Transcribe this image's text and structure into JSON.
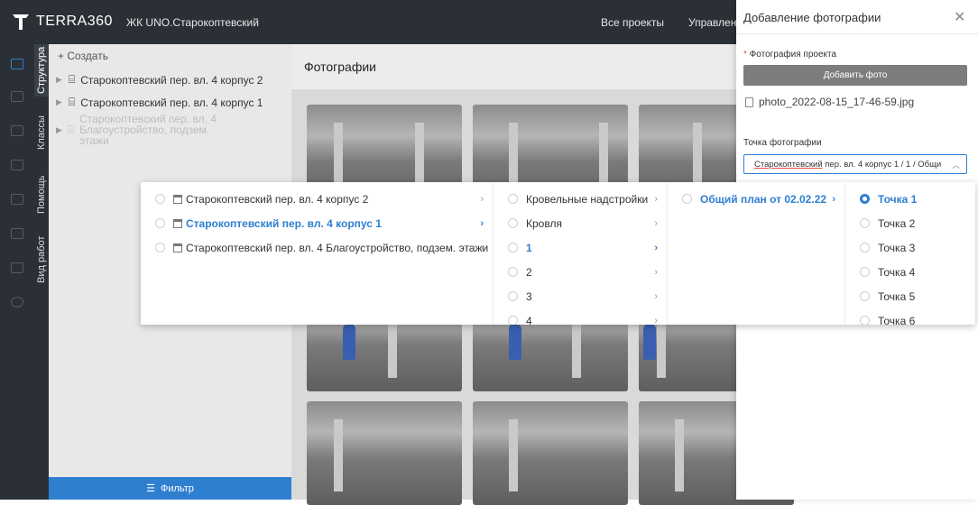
{
  "header": {
    "logo_text": "TERRA360",
    "project_name": "ЖК UNO.Старокоптевский",
    "nav": [
      "Все проекты",
      "Управление"
    ]
  },
  "vtabs": [
    "Структура",
    "Классы",
    "Помощь",
    "Вид работ"
  ],
  "tree": {
    "create_label": "Создать",
    "items": [
      "Старокоптевский пер. вл. 4 корпус 2",
      "Старокоптевский пер. вл. 4 корпус 1",
      "Старокоптевский пер. вл. 4 Благоустройство, подзем. этажи"
    ],
    "filter_label": "Фильтр"
  },
  "main": {
    "title": "Фотографии"
  },
  "panel": {
    "title": "Добавление фотографии",
    "photo_label": "Фотография проекта",
    "add_button": "Добавить фото",
    "file_name": "photo_2022-08-15_17-46-59.jpg",
    "point_label": "Точка фотографии",
    "select_underlined": "Старокоптевский",
    "select_rest": " пер. вл. 4 корпус 1  / 1 / Общи"
  },
  "cascader": {
    "col1": [
      "Старокоптевский пер. вл. 4 корпус 2",
      "Старокоптевский пер. вл. 4 корпус 1",
      "Старокоптевский пер. вл. 4 Благоустройство, подзем. этажи"
    ],
    "col2": [
      "Кровельные надстройки",
      "Кровля",
      "1",
      "2",
      "3",
      "4"
    ],
    "col3": [
      "Общий план от 02.02.22"
    ],
    "col4": [
      "Точка 1",
      "Точка 2",
      "Точка 3",
      "Точка 4",
      "Точка 5",
      "Точка 6"
    ]
  },
  "colors": {
    "accent": "#2f7fd1",
    "dark": "#2b3036"
  }
}
